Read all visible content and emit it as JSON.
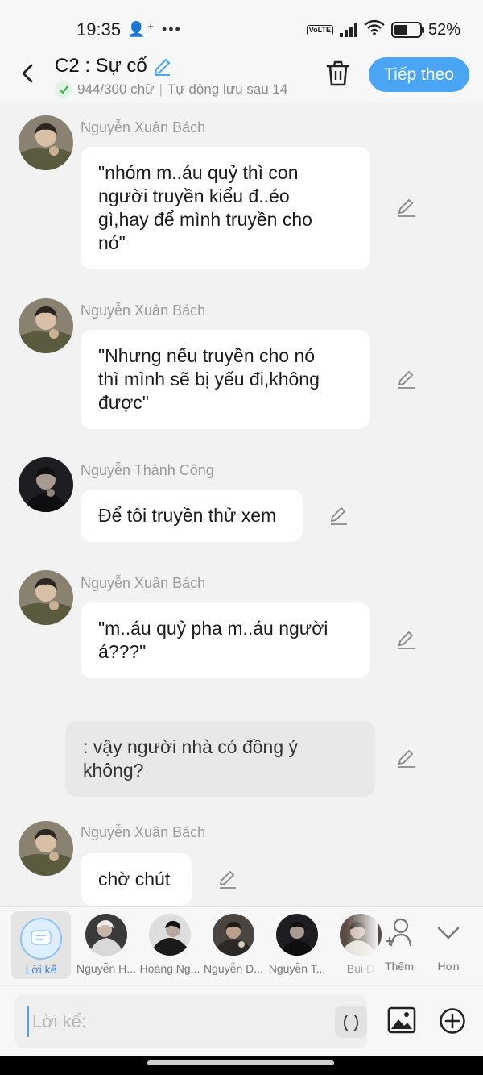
{
  "status_bar": {
    "time": "19:35",
    "notif_icons": "•••",
    "network": "VoLTE",
    "battery": "52%",
    "battery_level": 0.52
  },
  "header": {
    "title": "C2 : Sự cố",
    "word_count": "944/300 chữ",
    "autosave": "Tự động lưu sau 14",
    "next_label": "Tiếp theo"
  },
  "messages": [
    {
      "sender": "Nguyễn Xuân Bách",
      "lines": [
        "\"nhóm m..áu quỷ thì con",
        "người truyền kiểu đ..éo",
        "gì,hay để mình truyền cho",
        "nó\""
      ],
      "type": "character"
    },
    {
      "sender": "Nguyễn Xuân Bách",
      "lines": [
        "\"Nhưng nếu truyền cho nó",
        "thì mình sẽ bị yếu đi,không",
        "được\""
      ],
      "type": "character"
    },
    {
      "sender": "Nguyễn Thành Công",
      "lines": [
        "Để tôi truyền thử xem"
      ],
      "type": "character"
    },
    {
      "sender": "Nguyễn Xuân Bách",
      "lines": [
        "\"m..áu quỷ pha m..áu người",
        "á???\""
      ],
      "type": "character"
    },
    {
      "sender": "",
      "lines": [
        ": vậy người nhà có đồng ý",
        "không?"
      ],
      "type": "narration"
    },
    {
      "sender": "Nguyễn Xuân Bách",
      "lines": [
        "chờ chút"
      ],
      "type": "character"
    }
  ],
  "character_bar": {
    "narrator_label": "Lời kể",
    "characters": [
      "Nguyễn H...",
      "Hoàng Ng...",
      "Nguyễn D...",
      "Nguyễn T...",
      "Bùi D"
    ],
    "add_label": "Thêm",
    "more_label": "Hơn"
  },
  "input": {
    "placeholder": "Lời kể:",
    "paren_label": "( )"
  },
  "colors": {
    "accent": "#4aa6f5",
    "bubble": "#ffffff",
    "narration_bubble": "#e8e8e8",
    "background": "#f2f2f2"
  }
}
